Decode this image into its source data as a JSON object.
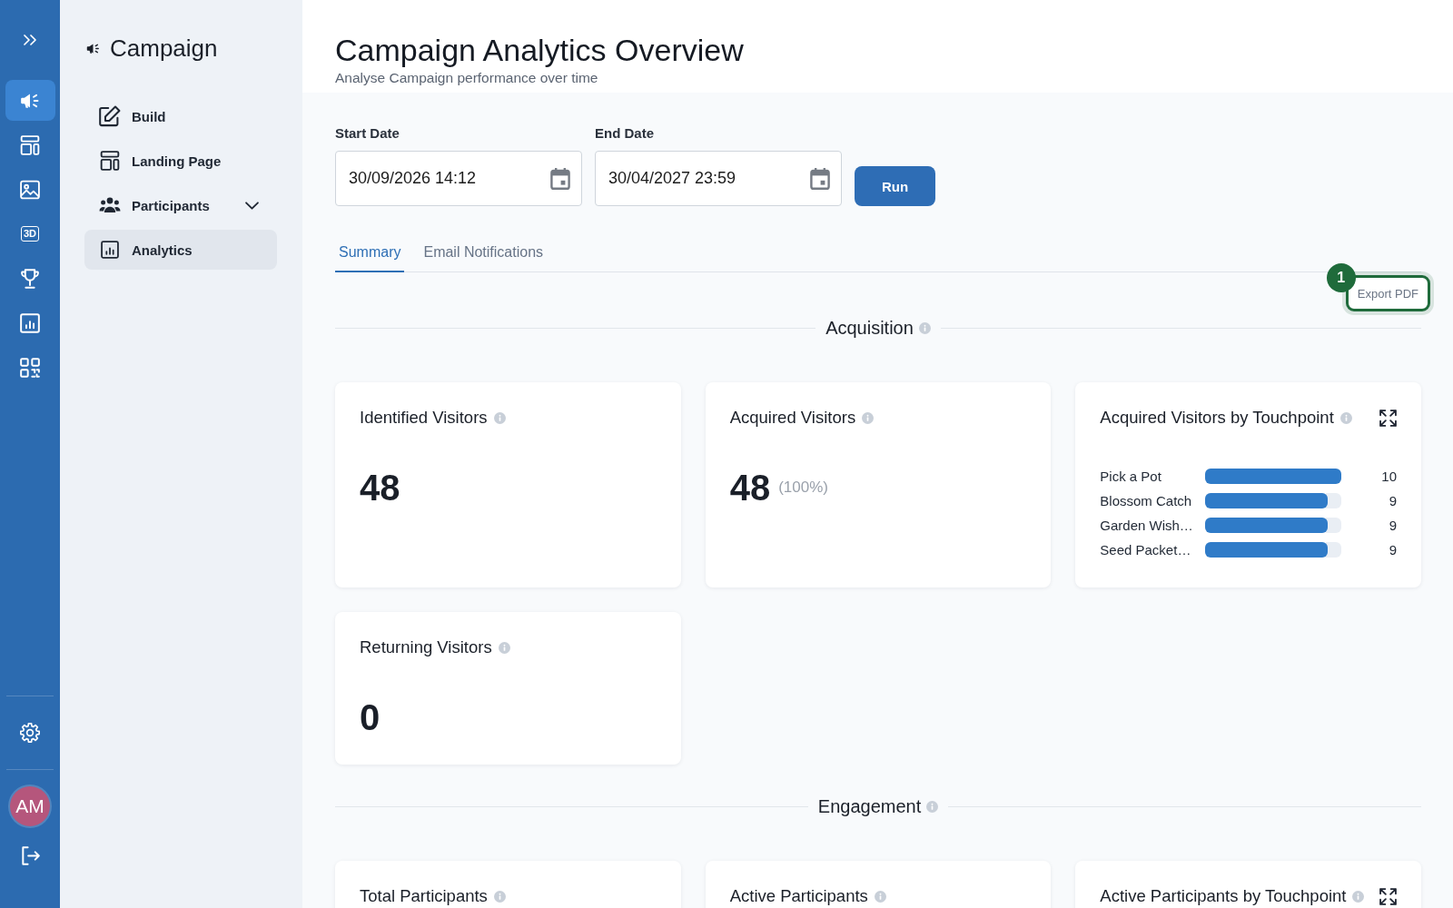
{
  "nav_rail": {
    "items": [
      {
        "kind": "icon",
        "selected": true
      },
      {
        "kind": "icon",
        "selected": false
      },
      {
        "kind": "icon",
        "selected": false
      },
      {
        "kind": "text",
        "text": "3D",
        "selected": false
      },
      {
        "kind": "icon",
        "selected": false
      },
      {
        "kind": "icon",
        "selected": false
      },
      {
        "kind": "icon",
        "selected": false
      }
    ],
    "user": {
      "initials": "AM"
    }
  },
  "sidebar": {
    "title": "Campaign",
    "items": [
      {
        "label": "Build",
        "selected": false
      },
      {
        "label": "Landing Page",
        "selected": false
      },
      {
        "label": "Participants",
        "selected": false,
        "expanded": false
      },
      {
        "label": "Analytics",
        "selected": true
      }
    ]
  },
  "header": {
    "title": "Campaign Analytics Overview",
    "subtitle": "Analyse Campaign performance over time"
  },
  "filters": {
    "start_date": {
      "label": "Start Date",
      "value": "30/09/2026 14:12"
    },
    "end_date": {
      "label": "End Date",
      "value": "30/04/2027 23:59"
    },
    "run_button": "Run"
  },
  "tabs": [
    {
      "label": "Summary",
      "selected": true
    },
    {
      "label": "Email Notifications",
      "selected": false
    }
  ],
  "export_button": {
    "label": "Export PDF",
    "step": "1",
    "highlighted": true
  },
  "sections": [
    {
      "title": "Acquisition",
      "cards": [
        {
          "kind": "stat",
          "title": "Identified Visitors",
          "value": "48"
        },
        {
          "kind": "stat",
          "title": "Acquired Visitors",
          "value": "48",
          "share": "(100%)"
        },
        {
          "kind": "chart",
          "title": "Acquired Visitors by Touchpoint",
          "chart_data": {
            "type": "bar",
            "orientation": "horizontal",
            "categories": [
              "Pick a Pot",
              "Blossom Catch",
              "Garden Wish…",
              "Seed Packet…"
            ],
            "values": [
              10,
              9,
              9,
              9
            ],
            "data_labels": true
          }
        },
        {
          "kind": "stat",
          "title": "Returning Visitors",
          "value": "0"
        }
      ]
    },
    {
      "title": "Engagement",
      "cards": [
        {
          "kind": "stat",
          "title": "Total Participants"
        },
        {
          "kind": "stat",
          "title": "Active Participants"
        },
        {
          "kind": "chart",
          "title": "Active Participants by Touchpoint"
        }
      ]
    }
  ]
}
